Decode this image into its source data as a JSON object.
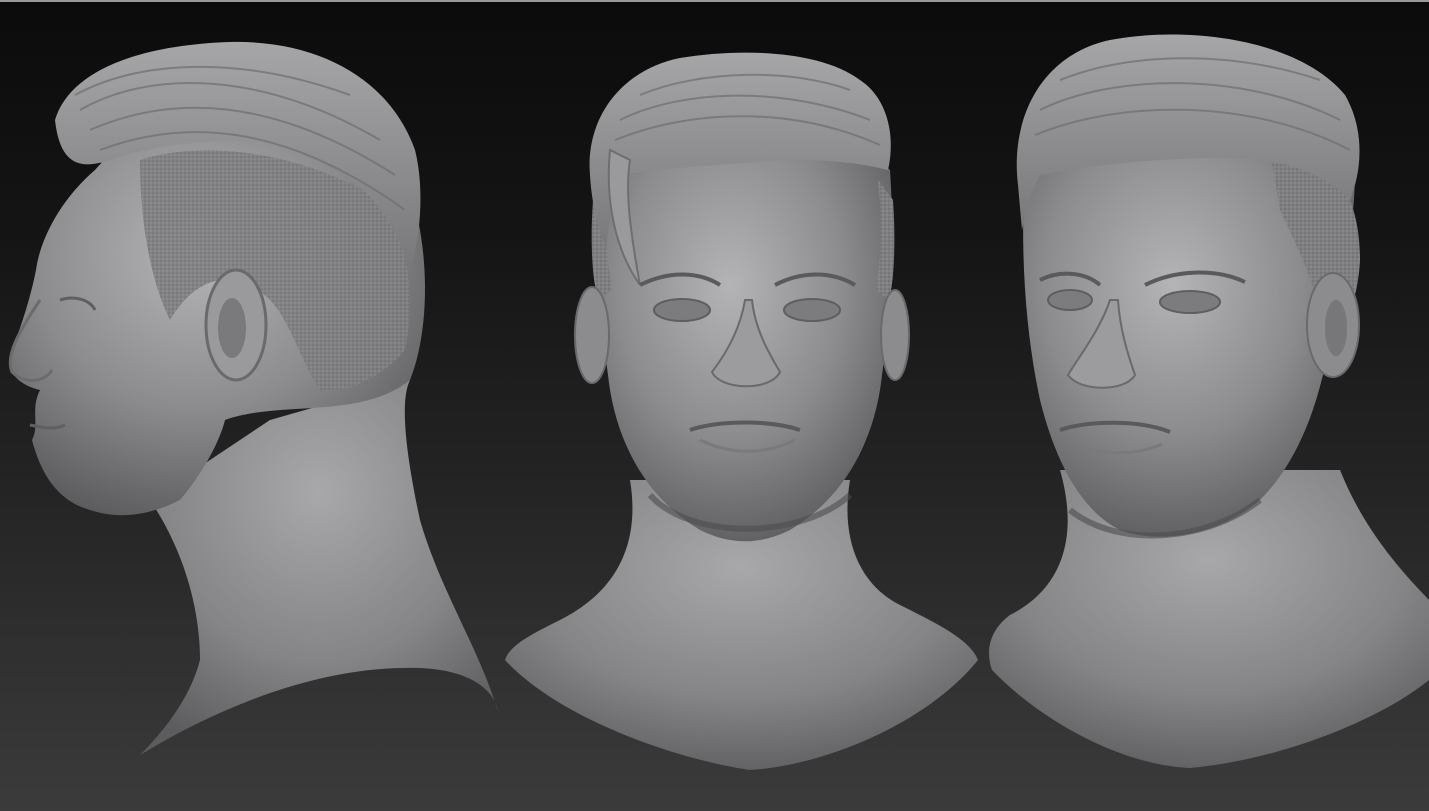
{
  "scene": {
    "description_free": true,
    "background": {
      "top_color": "#0b0b0b",
      "bottom_color": "#3b3b3b",
      "edge_color": "#9a9a9a"
    },
    "material_color": "#8e8e8e",
    "views": [
      {
        "id": "left",
        "orientation": "profile"
      },
      {
        "id": "front",
        "orientation": "front"
      },
      {
        "id": "three-quarter",
        "orientation": "three-quarter"
      }
    ]
  }
}
